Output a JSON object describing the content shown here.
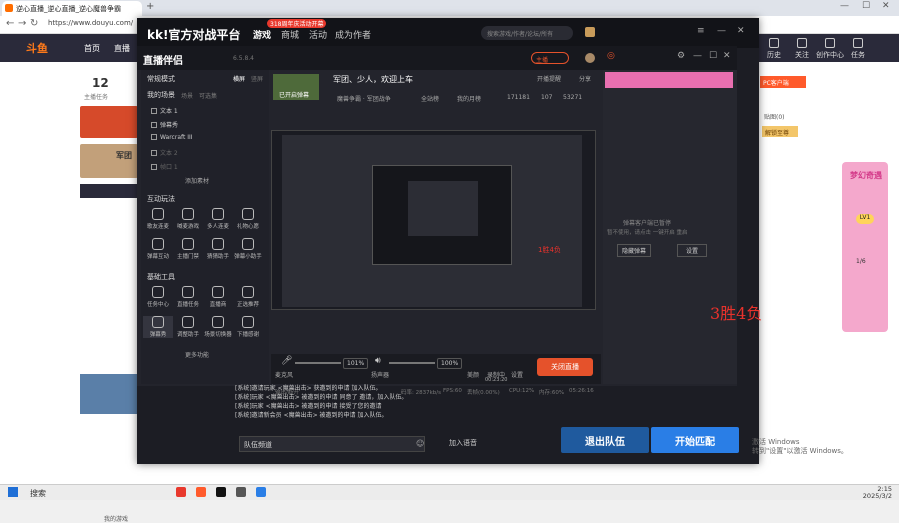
{
  "browser": {
    "tab_title": "逆心直播_逆心直播_逆心魔兽争霸",
    "url": "https://www.douyu.com/"
  },
  "douyu": {
    "logo": "斗鱼",
    "nav": [
      "首页",
      "直播"
    ],
    "right_items": [
      "历史",
      "关注",
      "创作中心",
      "任务",
      "礼物"
    ],
    "left_number": "12",
    "left_sub": "主播任务",
    "left_label": "军团",
    "pcbadge": "PC客户端",
    "right_label": "贴图(0)",
    "right_btn": "解锁至尊",
    "promo_title": "梦幻奇遇",
    "promo_sub": "LV1",
    "promo_count": "1/6"
  },
  "kk": {
    "logo": "kk!官方对战平台",
    "nav": [
      "游戏",
      "商城",
      "活动",
      "成为作者"
    ],
    "new_badge": "318周年庆活动开幕",
    "search_placeholder": "搜索游戏/作者/论坛/所有"
  },
  "live": {
    "logo": "直播伴侣",
    "version": "6.5.8.4",
    "mode": "常规模式",
    "mode_tabs": [
      "横屏",
      "竖屏"
    ],
    "scene_label": "我的场景",
    "scene_tabs": [
      "场景",
      "可选集"
    ],
    "sources": [
      "文本 1",
      "弹幕秀",
      "Warcraft III",
      "文本 2",
      "帧口 1"
    ],
    "add_source": "添加素材",
    "interact_title": "互动玩法",
    "interact": [
      "歌友连麦",
      "喊麦游戏",
      "多人连麦",
      "礼物心愿",
      "弹幕互动",
      "主播门禁",
      "猜猜助手",
      "弹幕小助手"
    ],
    "tools_title": "基础工具",
    "tools": [
      "任务中心",
      "直播任务",
      "直播商",
      "正选推荐",
      "弹幕秀",
      "调整助手",
      "场景切换器",
      "下播感谢"
    ],
    "more_tools": "更多功能",
    "room_title": "军团、少人，欢迎上车",
    "room_category": "魔兽争霸 · 军团战争",
    "room_status": "已开启弹幕",
    "stat_items": [
      "全站榜",
      "我的月榜",
      "171181",
      "107",
      "53271"
    ],
    "preview_room": "开播提醒",
    "share": "分享",
    "mic_label": "麦克风",
    "mic_pct": "101%",
    "speaker_label": "扬声器",
    "speaker_pct": "100%",
    "beauty": "美颜",
    "record_label": "录制中",
    "record_time": "00:23:20",
    "settings": "设置",
    "end_live": "关闭直播",
    "danmu_hint": "弹幕客户端已暂停",
    "danmu_sub": "暂不使用，请点击 一键开启 重启",
    "danmu_btns": [
      "隐藏弹幕",
      "设置"
    ],
    "status": [
      "码率: 2837kb/s",
      "FPS:60",
      "丢帧(0.00%)",
      "CPU:12%",
      "内存:60%",
      "05:26:16"
    ],
    "status_hint": "输出/断开",
    "in_preview": "1胜4负"
  },
  "chat": {
    "lines": [
      "[系统]邀请玩家 <魔兽出击> 获邀到的申请 加入队伍。",
      "[系统]玩家 <魔兽出击> 被邀到的申请 同意了 邀请，加入队伍。",
      "[系统]玩家 <魔兽出击> 被邀到的申请 接受了您的邀请",
      "[系统]邀请新会员 <魔兽出击> 被邀到的申请 加入队伍。"
    ],
    "channel": "队伍频道",
    "join_voice": "加入语音"
  },
  "actions": {
    "leave_team": "退出队伍",
    "start_match": "开始匹配",
    "my_games": "我的游戏"
  },
  "overlay_score": "3胜4负",
  "taskbar": {
    "search": "搜索",
    "time": "2:15",
    "date": "2025/3/2"
  },
  "watermark": [
    "激活 Windows",
    "转到\"设置\"以激活 Windows。"
  ],
  "colors": {
    "accent_orange": "#e5522b",
    "kk_blue": "#2a7ee6",
    "score_red": "#e8322c"
  }
}
